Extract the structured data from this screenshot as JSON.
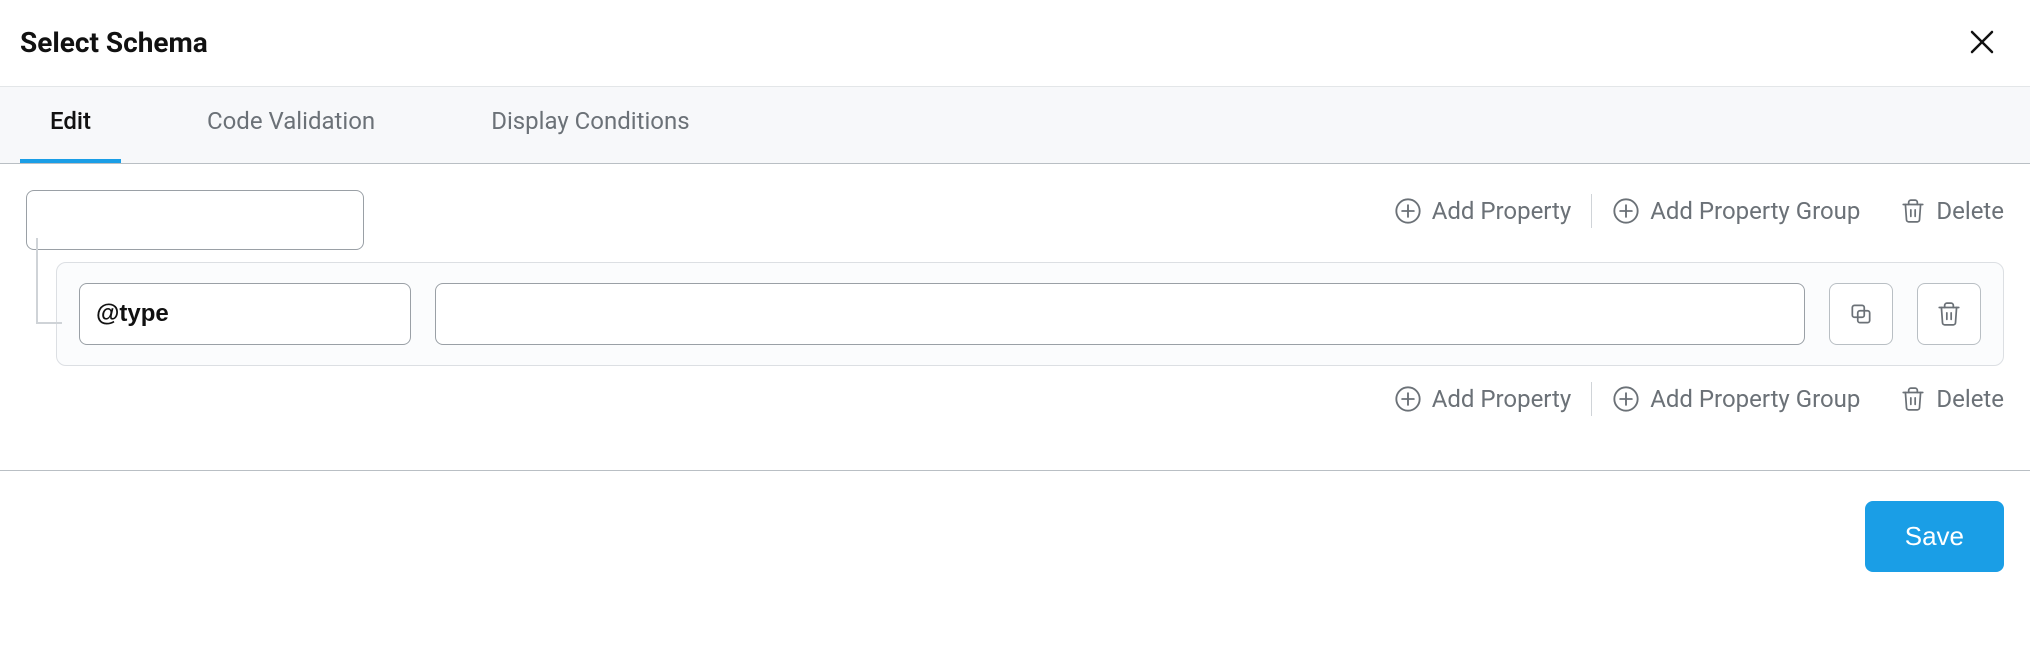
{
  "header": {
    "title": "Select Schema"
  },
  "tabs": [
    {
      "label": "Edit",
      "active": true
    },
    {
      "label": "Code Validation",
      "active": false
    },
    {
      "label": "Display Conditions",
      "active": false
    }
  ],
  "actions": {
    "add_property": "Add Property",
    "add_property_group": "Add Property Group",
    "delete": "Delete"
  },
  "root": {
    "name_value": ""
  },
  "property": {
    "key": "@type",
    "value": ""
  },
  "footer": {
    "save_label": "Save"
  }
}
